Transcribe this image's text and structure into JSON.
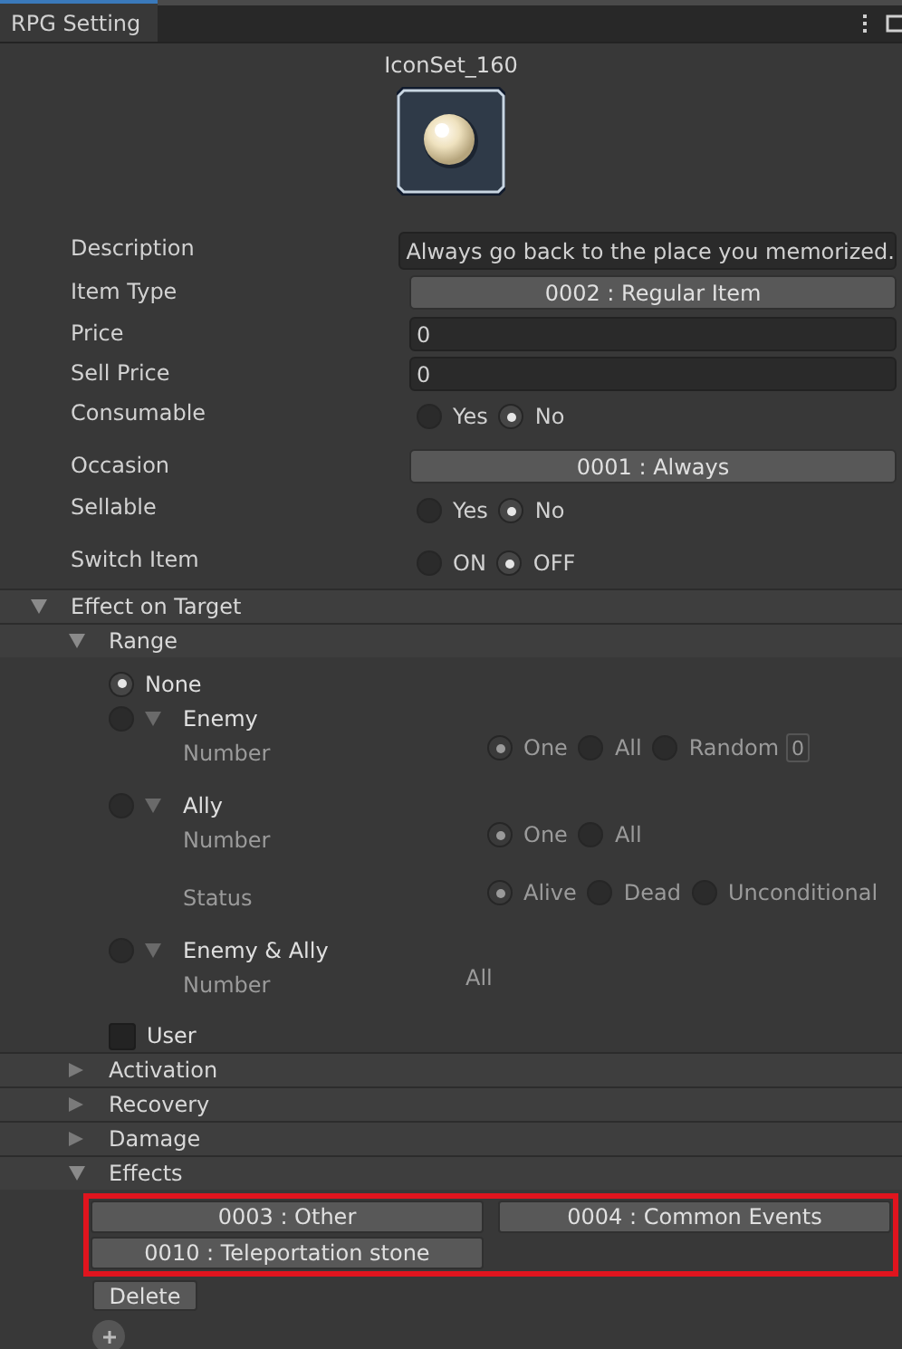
{
  "window": {
    "tab": "RPG Setting"
  },
  "icon": {
    "name": "IconSet_160"
  },
  "fields": [
    {
      "kind": "text",
      "label": "Description",
      "value": "Always go back to the place you memorized."
    },
    {
      "kind": "dropdown",
      "label": "Item Type",
      "value": "0002 : Regular Item"
    },
    {
      "kind": "number",
      "label": "Price",
      "value": "0"
    },
    {
      "kind": "number",
      "label": "Sell Price",
      "value": "0"
    },
    {
      "kind": "radio",
      "label": "Consumable",
      "options": [
        {
          "label": "Yes",
          "selected": false
        },
        {
          "label": "No",
          "selected": true
        }
      ]
    },
    {
      "kind": "dropdown",
      "label": "Occasion",
      "value": "0001 : Always"
    },
    {
      "kind": "radio",
      "label": "Sellable",
      "options": [
        {
          "label": "Yes",
          "selected": false
        },
        {
          "label": "No",
          "selected": true
        }
      ]
    },
    {
      "kind": "radio",
      "label": "Switch Item",
      "options": [
        {
          "label": "ON",
          "selected": false
        },
        {
          "label": "OFF",
          "selected": true
        }
      ]
    }
  ],
  "effect_on_target": {
    "title": "Effect on Target",
    "expanded": true,
    "range": {
      "title": "Range",
      "expanded": true,
      "options": [
        {
          "label": "None",
          "selected": true
        },
        {
          "label": "Enemy",
          "selected": false,
          "expanded": true,
          "settings": [
            {
              "label": "Number",
              "options": [
                {
                  "label": "One",
                  "selected": true
                },
                {
                  "label": "All",
                  "selected": false
                },
                {
                  "label": "Random",
                  "selected": false
                }
              ],
              "input": "0"
            }
          ]
        },
        {
          "label": "Ally",
          "selected": false,
          "expanded": true,
          "settings": [
            {
              "label": "Number",
              "options": [
                {
                  "label": "One",
                  "selected": true
                },
                {
                  "label": "All",
                  "selected": false
                }
              ]
            },
            {
              "label": "Status",
              "options": [
                {
                  "label": "Alive",
                  "selected": true
                },
                {
                  "label": "Dead",
                  "selected": false
                },
                {
                  "label": "Unconditional",
                  "selected": false
                }
              ]
            }
          ]
        },
        {
          "label": "Enemy & Ally",
          "selected": false,
          "expanded": true,
          "settings": [
            {
              "label": "Number",
              "value": "All"
            }
          ]
        }
      ]
    },
    "user": {
      "label": "User",
      "checked": false
    },
    "sections": [
      {
        "title": "Activation",
        "expanded": false
      },
      {
        "title": "Recovery",
        "expanded": false
      },
      {
        "title": "Damage",
        "expanded": false
      },
      {
        "title": "Effects",
        "expanded": true
      }
    ]
  },
  "effects": {
    "items": [
      "0003 : Other",
      "0004 : Common Events",
      "0010 : Teleportation stone"
    ],
    "delete": "Delete"
  }
}
